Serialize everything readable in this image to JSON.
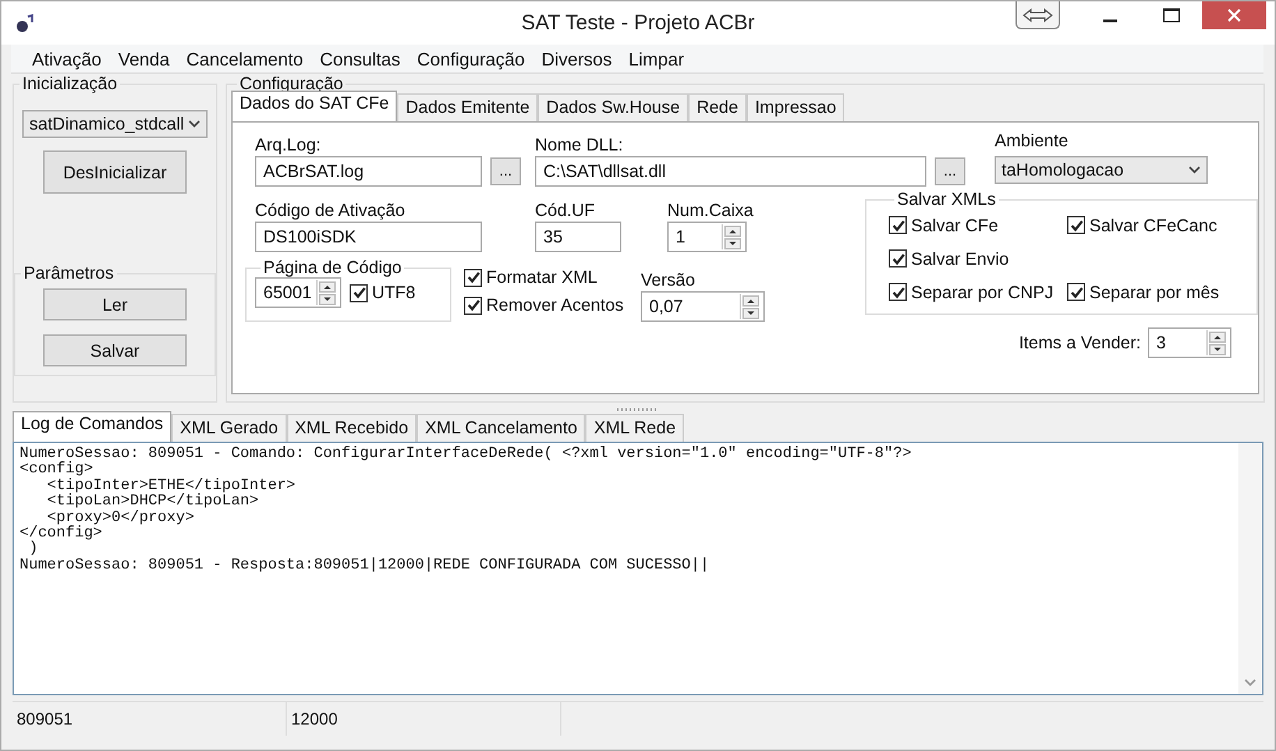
{
  "window": {
    "title": "SAT Teste - Projeto ACBr"
  },
  "menu": [
    "Ativação",
    "Venda",
    "Cancelamento",
    "Consultas",
    "Configuração",
    "Diversos",
    "Limpar"
  ],
  "inicializacao": {
    "title": "Inicialização",
    "library": "satDinamico_stdcall",
    "button": "DesInicializar",
    "parametros": {
      "title": "Parâmetros",
      "buttons": [
        "Ler",
        "Salvar"
      ]
    }
  },
  "configuracao": {
    "title": "Configuração",
    "tabs": [
      {
        "label": "Dados do SAT CFe",
        "selected": true
      },
      {
        "label": "Dados Emitente",
        "selected": false
      },
      {
        "label": "Dados Sw.House",
        "selected": false
      },
      {
        "label": "Rede",
        "selected": false
      },
      {
        "label": "Impressao",
        "selected": false
      }
    ],
    "arq_log": {
      "label": "Arq.Log:",
      "value": "ACBrSAT.log",
      "browse": "..."
    },
    "nome_dll": {
      "label": "Nome DLL:",
      "value": "C:\\SAT\\dllsat.dll",
      "browse": "..."
    },
    "ambiente": {
      "label": "Ambiente",
      "value": "taHomologacao"
    },
    "codigo_ativacao": {
      "label": "Código de Ativação",
      "value": "DS100iSDK"
    },
    "cod_uf": {
      "label": "Cód.UF",
      "value": "35"
    },
    "num_caixa": {
      "label": "Num.Caixa",
      "value": "1"
    },
    "pagina_codigo": {
      "title": "Página de Código",
      "value": "65001",
      "utf8": {
        "label": "UTF8",
        "checked": true
      }
    },
    "formatar_xml": {
      "label": "Formatar XML",
      "checked": true
    },
    "remover_acentos": {
      "label": "Remover Acentos",
      "checked": true
    },
    "versao": {
      "label": "Versão",
      "value": "0,07"
    },
    "salvar_xmls": {
      "title": "Salvar XMLs",
      "rows": [
        [
          {
            "label": "Salvar CFe",
            "checked": true
          },
          {
            "label": "Salvar CFeCanc",
            "checked": true
          }
        ],
        [
          {
            "label": "Salvar Envio",
            "checked": true
          }
        ],
        [
          {
            "label": "Separar por CNPJ",
            "checked": true
          },
          {
            "label": "Separar por mês",
            "checked": true
          }
        ]
      ]
    },
    "items_a_vender": {
      "label": "Items a Vender:",
      "value": "3"
    }
  },
  "log_tabs": [
    {
      "label": "Log de Comandos",
      "selected": true
    },
    {
      "label": "XML Gerado",
      "selected": false
    },
    {
      "label": "XML Recebido",
      "selected": false
    },
    {
      "label": "XML Cancelamento",
      "selected": false
    },
    {
      "label": "XML Rede",
      "selected": false
    }
  ],
  "log_lines": [
    "NumeroSessao: 809051 - Comando: ConfigurarInterfaceDeRede( <?xml version=\"1.0\" encoding=\"UTF-8\"?>",
    "<config>",
    "   <tipoInter>ETHE</tipoInter>",
    "   <tipoLan>DHCP</tipoLan>",
    "   <proxy>0</proxy>",
    "</config>",
    " )",
    "NumeroSessao: 809051 - Resposta:809051|12000|REDE CONFIGURADA COM SUCESSO||"
  ],
  "status_bar": [
    "809051",
    "12000"
  ]
}
